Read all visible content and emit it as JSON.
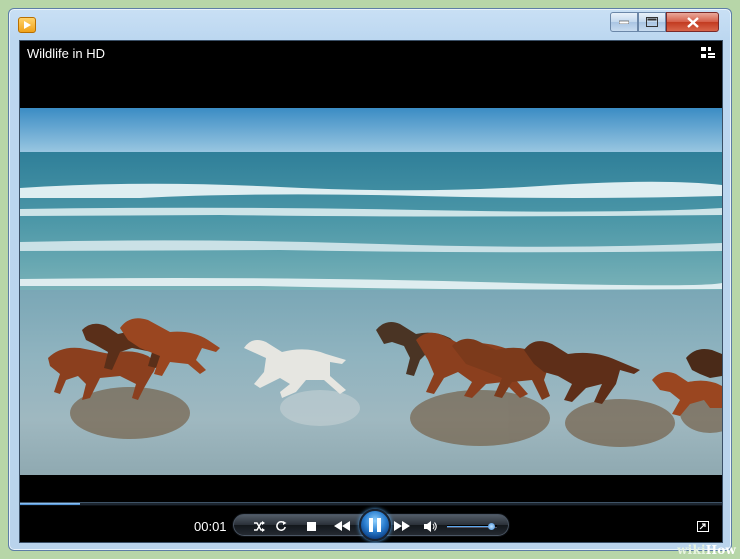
{
  "window": {
    "minimize_icon": "minimize-icon",
    "maximize_icon": "maximize-icon",
    "close_icon": "close-icon"
  },
  "player": {
    "video_title": "Wildlife in HD",
    "switch_to_library_icon": "switch-to-library-icon",
    "elapsed_time": "00:01",
    "seek_progress": 0.085,
    "volume_level": 0.88,
    "controls": {
      "shuffle_icon": "shuffle-icon",
      "repeat_icon": "repeat-icon",
      "stop_icon": "stop-icon",
      "previous_icon": "previous-icon",
      "pause_icon": "pause-icon",
      "next_icon": "next-icon",
      "volume_icon": "speaker-icon",
      "fullscreen_icon": "fullscreen-icon"
    }
  },
  "watermark": {
    "wiki": "wiki",
    "how": "How"
  },
  "colors": {
    "accent": "#3f82c8",
    "player_bg": "#000000",
    "frame_bg": "#b9d3ec",
    "close_red": "#c23a20"
  }
}
